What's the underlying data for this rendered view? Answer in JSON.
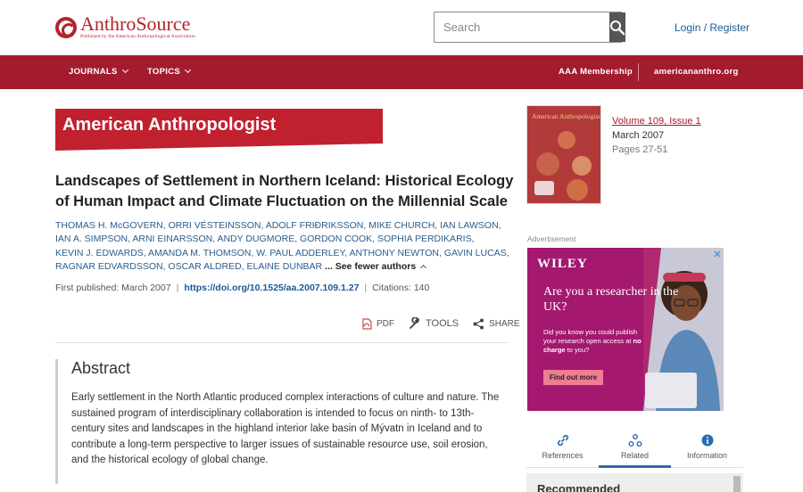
{
  "header": {
    "logo_name": "AnthroSource",
    "logo_sub": "Published by the American Anthropological Association",
    "search_placeholder": "Search",
    "login_label": "Login / Register"
  },
  "nav": {
    "journals": "JOURNALS",
    "topics": "TOPICS",
    "membership": "AAA Membership",
    "site": "americananthro.org"
  },
  "journal": {
    "banner_title": "American Anthropologist"
  },
  "article": {
    "title": "Landscapes of Settlement in Northern Iceland: Historical Ecology of Human Impact and Climate Fluctuation on the Millennial Scale",
    "authors_line1": "THOMAS H. McGOVERN, ORRI VÉSTEINSSON, ADOLF FRIÐRIKSSON, MIKE CHURCH, IAN LAWSON,",
    "authors_line2": "IAN A. SIMPSON, ARNI EINARSSON, ANDY DUGMORE, GORDON COOK, SOPHIA PERDIKARIS,",
    "authors_line3": "KEVIN J. EDWARDS, AMANDA M. THOMSON, W. PAUL ADDERLEY, ANTHONY NEWTON, GAVIN LUCAS,",
    "authors_line4": "RAGNAR EDVARDSSON, OSCAR ALDRED, ELAINE DUNBAR",
    "see_fewer": "... See fewer authors",
    "first_published_label": "First published:",
    "first_published_value": "March 2007",
    "doi": "https://doi.org/10.1525/aa.2007.109.1.27",
    "citations": "Citations: 140"
  },
  "tools": {
    "pdf": "PDF",
    "tools": "TOOLS",
    "share": "SHARE"
  },
  "abstract": {
    "heading": "Abstract",
    "text": "Early settlement in the North Atlantic produced complex interactions of culture and nature. The sustained program of interdisciplinary collaboration is intended to focus on ninth- to 13th-century sites and landscapes in the highland interior lake basin of Mývatn in Iceland and to contribute a long-term perspective to larger issues of sustainable resource use, soil erosion, and the historical ecology of global change."
  },
  "issue": {
    "volume_label": "Volume 109, Issue 1",
    "date": "March 2007",
    "pages": "Pages 27-51",
    "cover_title": "American Anthropologist"
  },
  "ad": {
    "label": "Advertisement",
    "brand": "WILEY",
    "headline": "Are you a researcher in the UK?",
    "body_pre": "Did you know you could publish your research open access at ",
    "body_bold": "no charge",
    "body_post": " to you?",
    "button": "Find out more"
  },
  "tabs": {
    "references": "References",
    "related": "Related",
    "information": "Information"
  },
  "recommended": {
    "heading": "Recommended"
  },
  "colors": {
    "brand_red": "#a21c2d",
    "banner_red": "#c1202e",
    "link_blue": "#1a5a96",
    "ad_magenta": "#a4186f"
  }
}
